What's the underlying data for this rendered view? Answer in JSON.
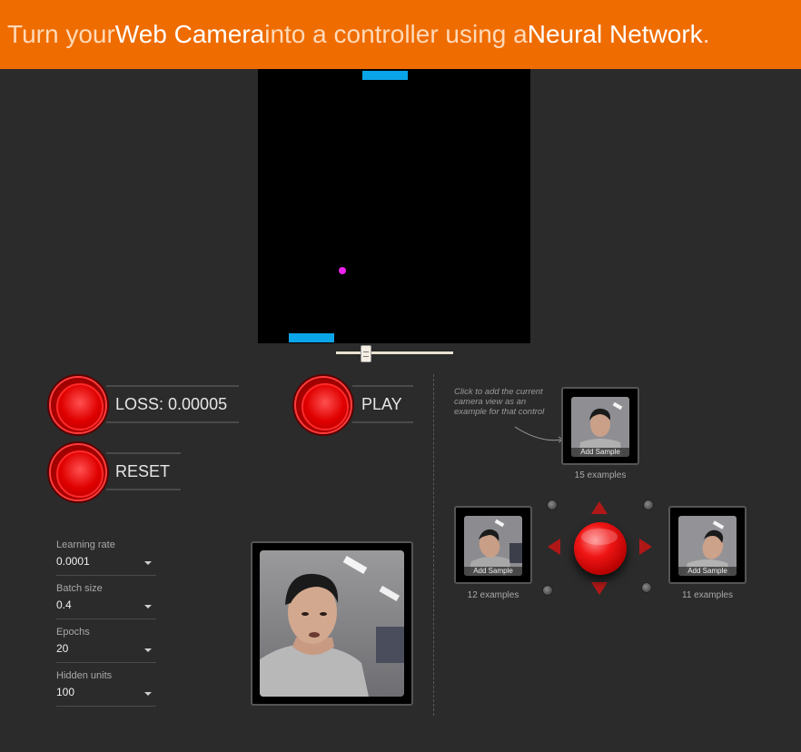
{
  "header": {
    "part1": "Turn your ",
    "highlight1": "Web Camera",
    "part2": " into a controller using a ",
    "highlight2": "Neural Network",
    "part3": "."
  },
  "controls": {
    "train_label": "LOSS: 0.00005",
    "play_label": "PLAY",
    "reset_label": "RESET"
  },
  "hyperparams": [
    {
      "label": "Learning rate",
      "value": "0.0001"
    },
    {
      "label": "Batch size",
      "value": "0.4"
    },
    {
      "label": "Epochs",
      "value": "20"
    },
    {
      "label": "Hidden units",
      "value": "100"
    }
  ],
  "hint": "Click to add the current camera view as an example for that control",
  "samples": {
    "up": {
      "button_label": "Add Sample",
      "count": "15 examples"
    },
    "left": {
      "button_label": "Add Sample",
      "count": "12 examples"
    },
    "right": {
      "button_label": "Add Sample",
      "count": "11 examples"
    }
  },
  "colors": {
    "header_bg": "#ef6c00",
    "paddle": "#0aa5e8",
    "ball": "#ee22ee",
    "button_red": "#e00000",
    "background": "#2b2b2b"
  }
}
